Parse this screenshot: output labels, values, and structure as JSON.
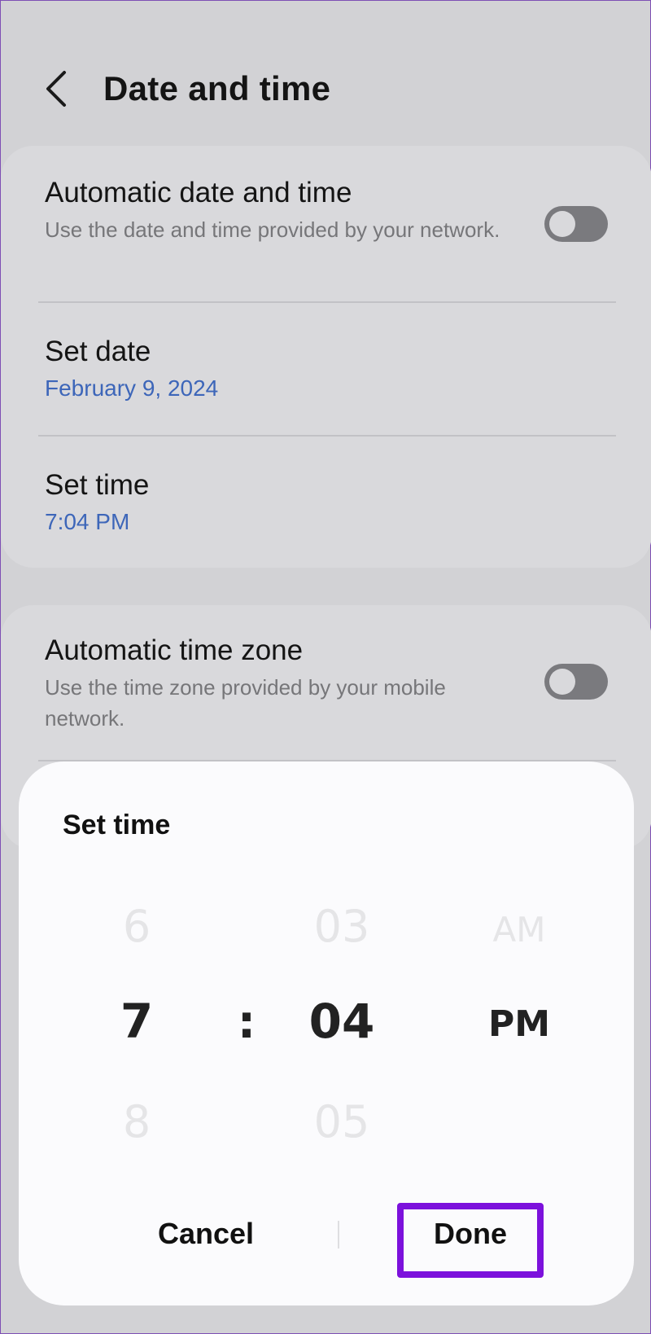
{
  "header": {
    "back_icon": "chevron-left-icon",
    "title": "Date and time"
  },
  "settings": {
    "auto_date_time": {
      "title": "Automatic date and time",
      "subtitle": "Use the date and time provided by your network.",
      "toggle_on": false
    },
    "set_date": {
      "title": "Set date",
      "value": "February 9, 2024"
    },
    "set_time": {
      "title": "Set time",
      "value": "7:04 PM"
    },
    "auto_time_zone": {
      "title": "Automatic time zone",
      "subtitle": "Use the time zone provided by your mobile network.",
      "toggle_on": false
    }
  },
  "dialog": {
    "title": "Set time",
    "hour": {
      "prev": "6",
      "current": "7",
      "next": "8"
    },
    "separator": ":",
    "minute": {
      "prev": "03",
      "current": "04",
      "next": "05"
    },
    "ampm": {
      "prev": "AM",
      "current": "PM"
    },
    "cancel_label": "Cancel",
    "done_label": "Done"
  },
  "colors": {
    "background": "#d2d2d5",
    "card": "#d9d9dc",
    "link_value": "#3d66b9",
    "highlight": "#7c11dc",
    "dialog": "#fbfbfd"
  }
}
